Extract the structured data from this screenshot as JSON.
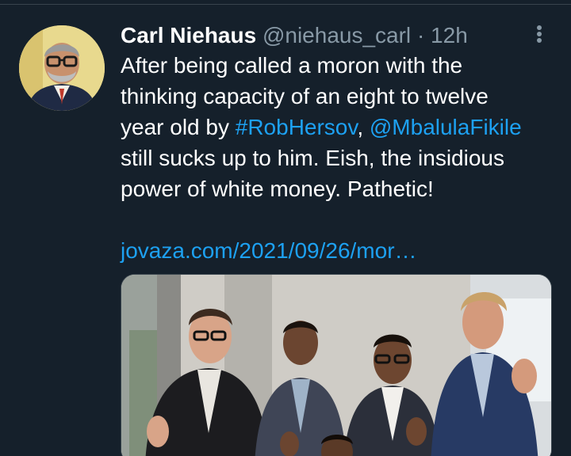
{
  "tweet": {
    "display_name": "Carl Niehaus",
    "handle": "@niehaus_carl",
    "separator": "·",
    "time": "12h",
    "lines": [
      {
        "text": "After being called a moron with the"
      },
      {
        "text": "thinking capacity of an eight to twelve"
      },
      {
        "prefix": "year old by ",
        "mention1": "#RobHersov",
        "middle": ", ",
        "mention2": "@MbalulaFikile"
      },
      {
        "text": "still sucks up to him. Eish, the insidious"
      },
      {
        "text": "power of white money. Pathetic!"
      }
    ],
    "link": "jovaza.com/2021/09/26/mor…"
  },
  "icons": {
    "avatar": "user-avatar-photo",
    "more": "more-vertical-icon",
    "media": "photo-four-men-thumbs-up"
  },
  "colors": {
    "background": "#15202b",
    "text": "#ffffff",
    "muted": "#8899a6",
    "link": "#1da1f2",
    "border": "#38444d"
  }
}
